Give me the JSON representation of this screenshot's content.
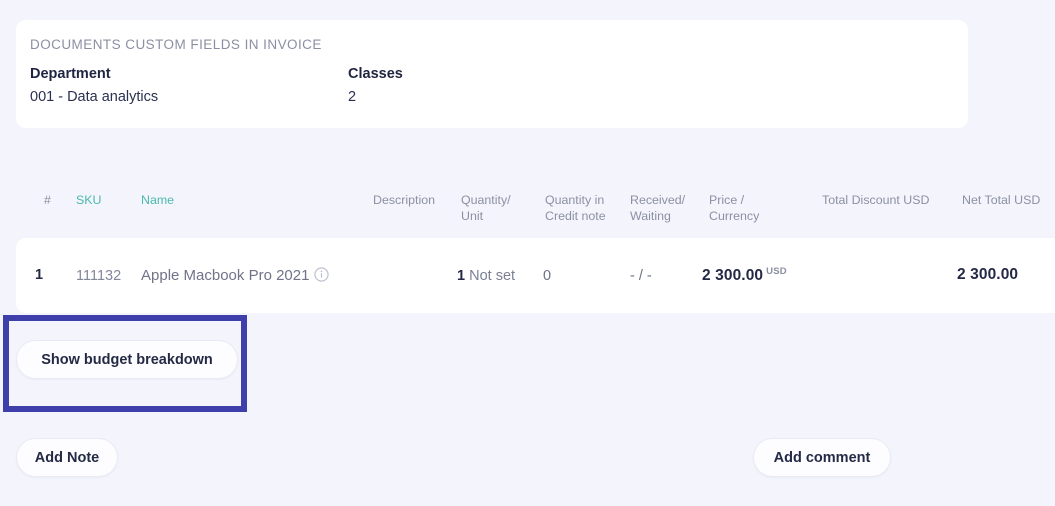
{
  "custom_fields": {
    "title": "DOCUMENTS CUSTOM FIELDS IN INVOICE",
    "fields": [
      {
        "label": "Department",
        "value": "001 - Data analytics"
      },
      {
        "label": "Classes",
        "value": "2"
      }
    ]
  },
  "items_table": {
    "columns": {
      "num": "#",
      "sku": "SKU",
      "name": "Name",
      "description": "Description",
      "quantity_line1": "Quantity/",
      "quantity_line2": "Unit",
      "qty_credit_line1": "Quantity in",
      "qty_credit_line2": "Credit note",
      "received_line1": "Received/",
      "received_line2": "Waiting",
      "price_line1_main": "Price",
      "price_line1_sub": " /",
      "price_line2": "Currency",
      "total_discount": "Total Discount USD",
      "net_total": "Net Total USD"
    },
    "rows": [
      {
        "num": "1",
        "sku": "111132",
        "name": "Apple Macbook Pro 2021",
        "name_info_icon": "info-icon",
        "description": "",
        "quantity": "1",
        "unit": "Not set",
        "qty_credit_note": "0",
        "received_waiting": "- / -",
        "price": "2 300.00",
        "price_currency": "USD",
        "total_discount": "",
        "net_total": "2 300.00"
      }
    ]
  },
  "actions": {
    "show_budget_breakdown": "Show budget breakdown",
    "add_note": "Add Note",
    "add_comment": "Add comment"
  },
  "colors": {
    "page_background": "#f4f5fc",
    "card_background": "#ffffff",
    "accent_teal": "#4bb8ae",
    "text_dark": "#242a45",
    "text_muted": "#8b8fa3",
    "highlight_border": "#3f3fab"
  }
}
